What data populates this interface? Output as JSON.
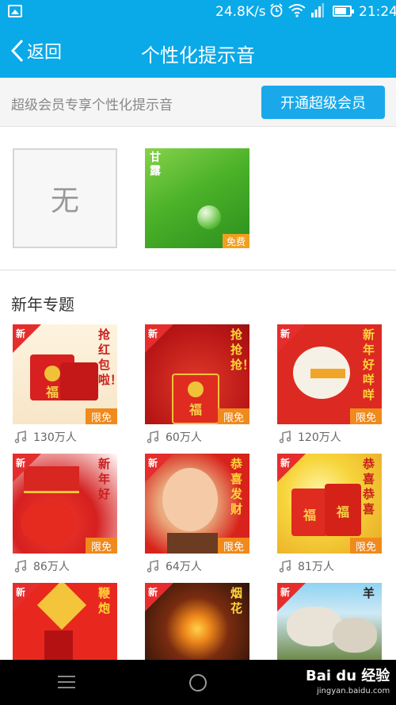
{
  "status_bar": {
    "net_speed": "24.8K/s",
    "time": "21:24",
    "icons": [
      "picture-icon",
      "alarm-icon",
      "wifi-icon",
      "signal-icon",
      "battery-icon"
    ]
  },
  "header": {
    "back_label": "返回",
    "title": "个性化提示音"
  },
  "promo": {
    "text": "超级会员专享个性化提示音",
    "button_label": "开通超级会员"
  },
  "tones": [
    {
      "label": "无"
    },
    {
      "label": "甘露",
      "badge": "免费"
    }
  ],
  "section": {
    "title": "新年专题"
  },
  "new_badge": "新",
  "limit_badge": "限免",
  "items": [
    {
      "label": "抢红包啦！",
      "count": "130万人",
      "theme": "envelope-cream"
    },
    {
      "label": "抢抢抢！",
      "count": "60万人",
      "theme": "envelope-red"
    },
    {
      "label": "新年好咩咩",
      "count": "120万人",
      "theme": "sheep"
    },
    {
      "label": "新年好",
      "count": "86万人",
      "theme": "lanterns"
    },
    {
      "label": "恭喜发财",
      "count": "64万人",
      "theme": "baby"
    },
    {
      "label": "恭喜恭喜",
      "count": "81万人",
      "theme": "envelopes-gold"
    },
    {
      "label": "鞭炮",
      "count": "",
      "theme": "firecracker"
    },
    {
      "label": "烟花",
      "count": "",
      "theme": "fireworks"
    },
    {
      "label": "羊",
      "count": "",
      "theme": "sheep-photo"
    }
  ],
  "watermark": {
    "brand": "Bai du 经验",
    "url": "jingyan.baidu.com"
  },
  "colors": {
    "primary": "#0aa9e8",
    "new_badge": "#e52d2d",
    "limit_badge": "#f08a1c"
  }
}
